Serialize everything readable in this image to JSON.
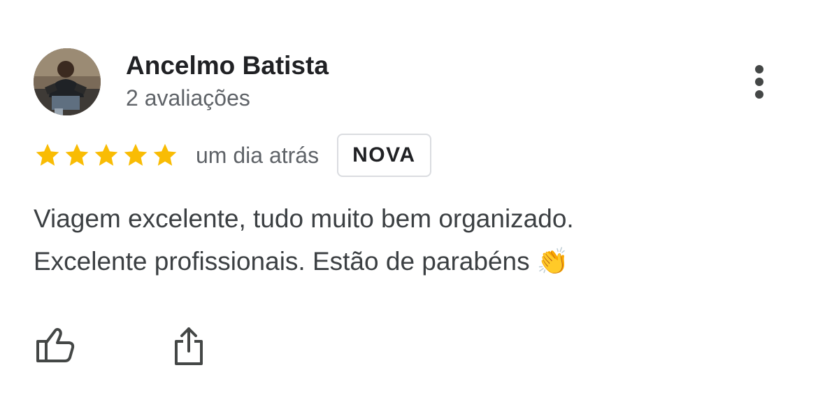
{
  "review": {
    "author_name": "Ancelmo Batista",
    "review_count": "2 avaliações",
    "rating": 5,
    "rating_max": 5,
    "date": "um dia atrás",
    "badge": "NOVA",
    "text_lines": [
      "Viagem excelente, tudo muito bem organizado.",
      "Excelente profissionais. Estão de parabéns 👏"
    ]
  },
  "icons": {
    "more": "more-vertical-icon",
    "like": "thumbs-up-icon",
    "share": "share-icon",
    "star": "star-icon",
    "avatar": "user-avatar-photo"
  },
  "colors": {
    "star": "#F9BC04",
    "author": "#202124",
    "secondary_text": "#5F6368",
    "body_text": "#3C4043",
    "badge_border": "#DADCE0",
    "icon": "#444746"
  }
}
